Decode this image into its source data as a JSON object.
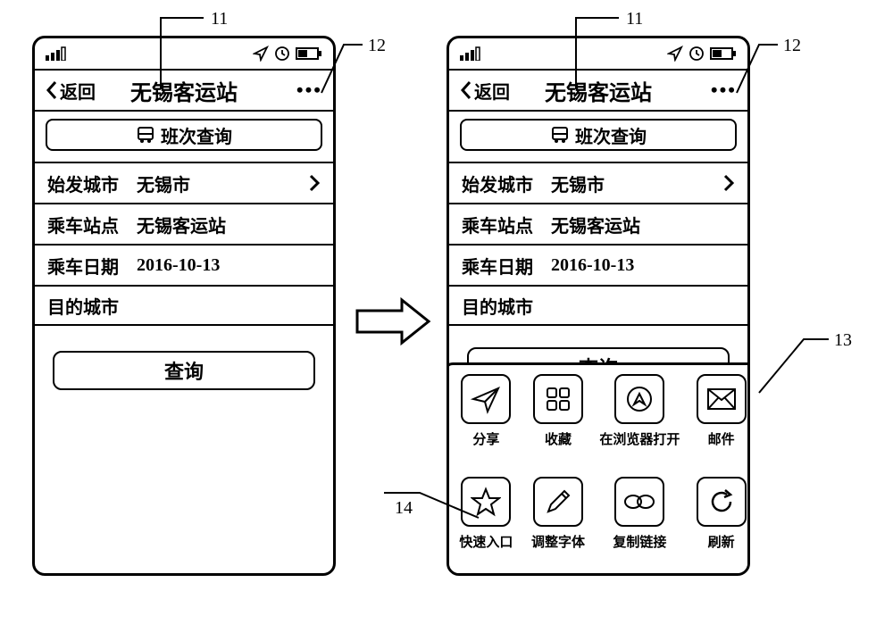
{
  "callouts": {
    "c11": "11",
    "c12": "12",
    "c13": "13",
    "c14": "14"
  },
  "nav": {
    "back": "返回",
    "title": "无锡客运站",
    "subtitle": "班次查询"
  },
  "fields": {
    "origin_city_label": "始发城市",
    "origin_city_value": "无锡市",
    "board_stop_label": "乘车站点",
    "board_stop_value": "无锡客运站",
    "ride_date_label": "乘车日期",
    "ride_date_value": "2016-10-13",
    "dest_city_label": "目的城市",
    "dest_city_value": ""
  },
  "query_btn": "查询",
  "sheet": {
    "i0": "分享",
    "i1": "收藏",
    "i2": "在浏览器打开",
    "i3": "邮件",
    "i4": "快速入口",
    "i5": "调整字体",
    "i6": "复制链接",
    "i7": "刷新"
  }
}
